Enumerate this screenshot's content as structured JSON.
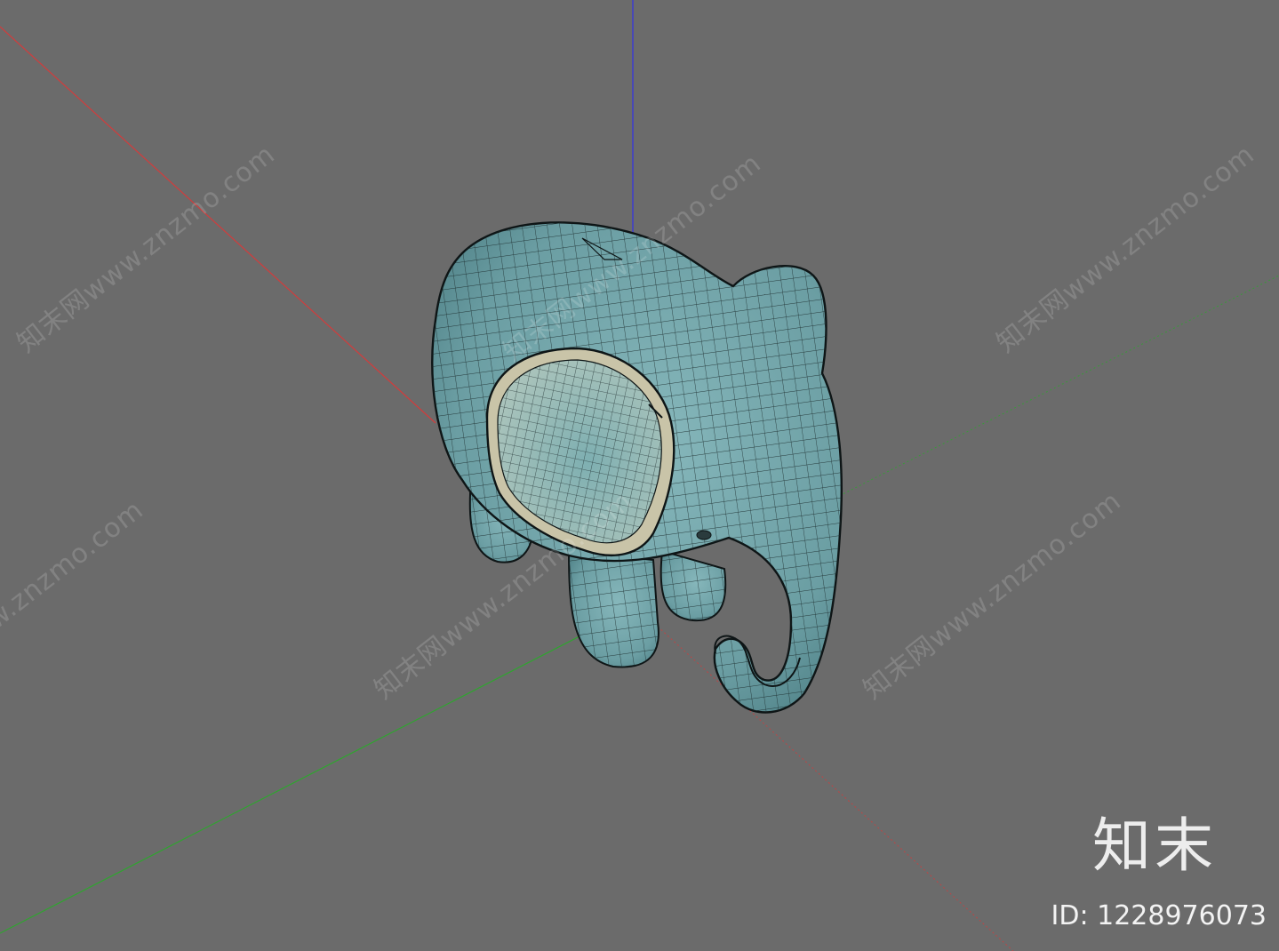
{
  "viewport": {
    "background_color": "#6b6b6b",
    "axis_colors": {
      "x": "#d23c3c",
      "y": "#2fa52f",
      "z": "#3a3ad6"
    }
  },
  "model": {
    "name_icon": "elephant-wireframe-model",
    "surface_color": "#6fa3a8",
    "ear_inner_color": "#9fbcb5",
    "ear_rim_color": "#c9c4a8",
    "wire_color": "#1b2a2c"
  },
  "watermarks": {
    "text": "知末网www.znzmo.com"
  },
  "brand": {
    "logo": "知末",
    "id_label": "ID: 1228976073"
  }
}
